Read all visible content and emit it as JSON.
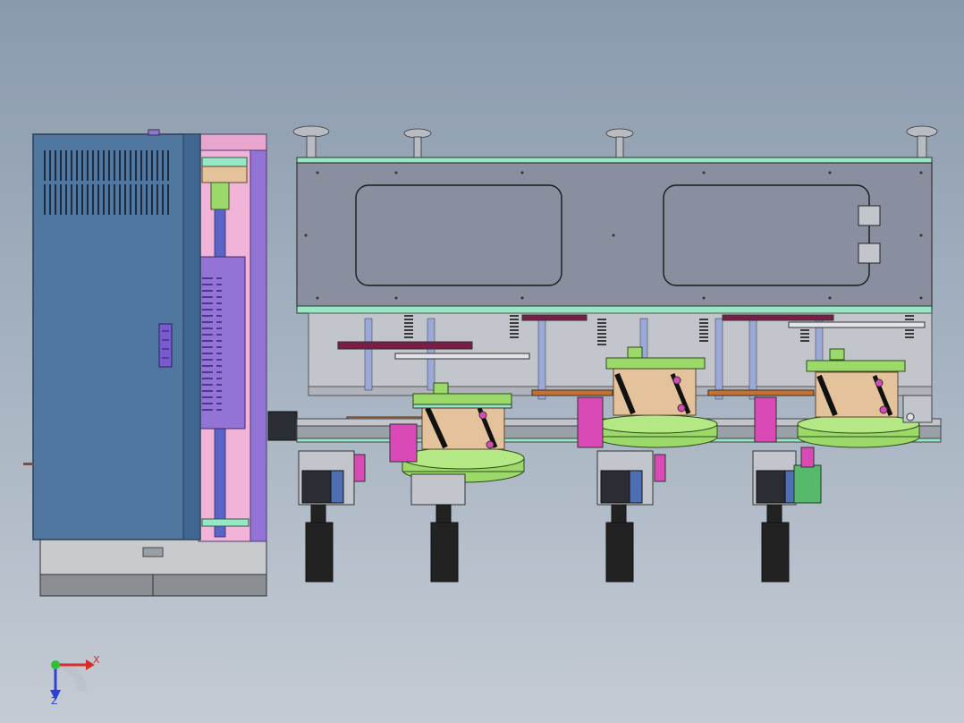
{
  "viewport": {
    "background_top": "#8a9aad",
    "background_bottom": "#c4cbd4"
  },
  "colors": {
    "cabinet_blue": "#5077a0",
    "cabinet_edge": "#2d3e55",
    "pink_frame": "#f2b3d8",
    "purple_panel": "#9473d6",
    "steel_gray": "#8a8fa0",
    "light_gray": "#c2c6cc",
    "mint_strip": "#96e8c4",
    "green_disc": "#9bd96b",
    "tan_cylinder": "#e4c39c",
    "magenta_part": "#d94ab6",
    "maroon_bar": "#7a1e46",
    "orange_bar": "#c7702f",
    "black_part": "#222222"
  },
  "triad": {
    "x_label": "X",
    "z_label": "Z",
    "x_color": "#d92b2b",
    "y_color": "#2fbf3a",
    "z_color": "#2c3fd6"
  }
}
